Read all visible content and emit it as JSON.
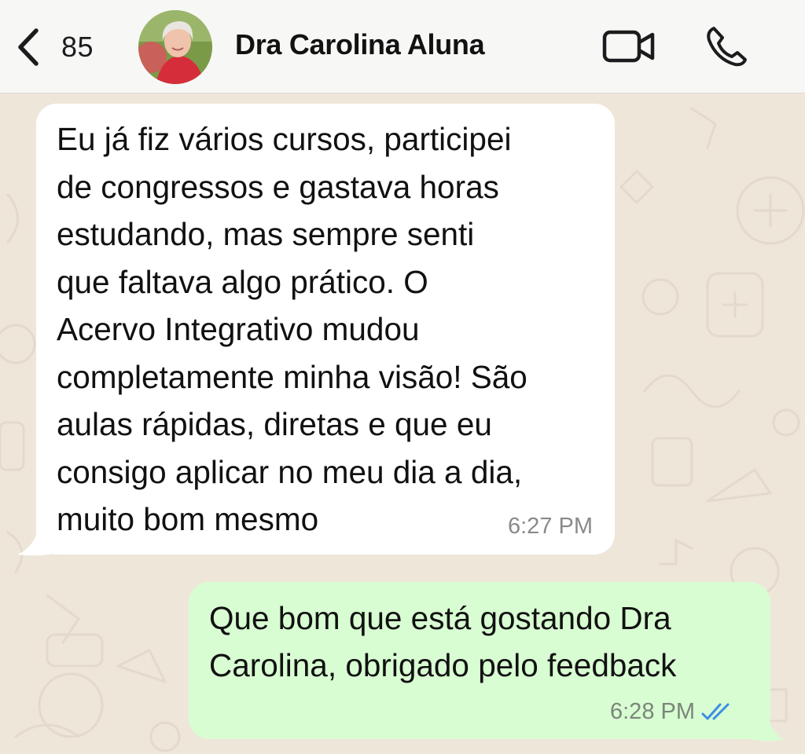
{
  "header": {
    "back_count": "85",
    "contact_name": "Dra Carolina Aluna",
    "icons": [
      "chevron-left-icon",
      "video-camera-icon",
      "phone-icon"
    ]
  },
  "messages": [
    {
      "direction": "incoming",
      "text": "Eu já fiz vários cursos, participei\nde congressos e gastava horas\nestudando, mas sempre senti\nque faltava algo prático. O\nAcervo Integrativo mudou\ncompletamente minha visão! São\naulas rápidas, diretas e que eu\nconsigo aplicar no meu dia a dia,\nmuito bom mesmo",
      "time": "6:27 PM"
    },
    {
      "direction": "outgoing",
      "text": "Que bom que está gostando Dra\nCarolina, obrigado pelo feedback",
      "time": "6:28 PM",
      "status": "read"
    }
  ],
  "colors": {
    "header_bg": "#f7f7f5",
    "chat_bg": "#efe6da",
    "incoming_bubble": "#ffffff",
    "outgoing_bubble": "#d8fdd2",
    "read_ticks": "#3a8ee6"
  }
}
